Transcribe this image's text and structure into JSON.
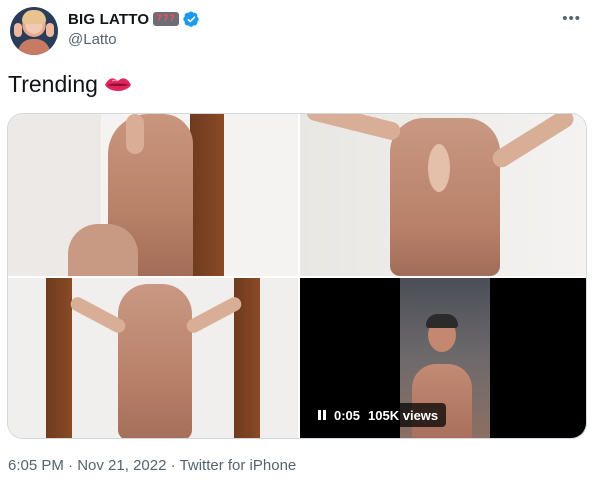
{
  "author": {
    "display_name": "BIG LATTO",
    "handle": "@Latto",
    "slot_emoji": "777"
  },
  "tweet": {
    "text": "Trending"
  },
  "media": {
    "video": {
      "time": "0:05",
      "views": "105K views"
    }
  },
  "meta": {
    "time": "6:05 PM",
    "sep1": "·",
    "date": "Nov 21, 2022",
    "sep2": "·",
    "source": "Twitter for iPhone"
  },
  "colors": {
    "verified": "#1d9bf0",
    "secondary_text": "#536471",
    "lips": "#e0245e"
  },
  "icons": {
    "verified": "verified-badge-icon",
    "more": "more-options-icon",
    "lips": "lips-emoji-icon",
    "pause": "pause-icon"
  }
}
